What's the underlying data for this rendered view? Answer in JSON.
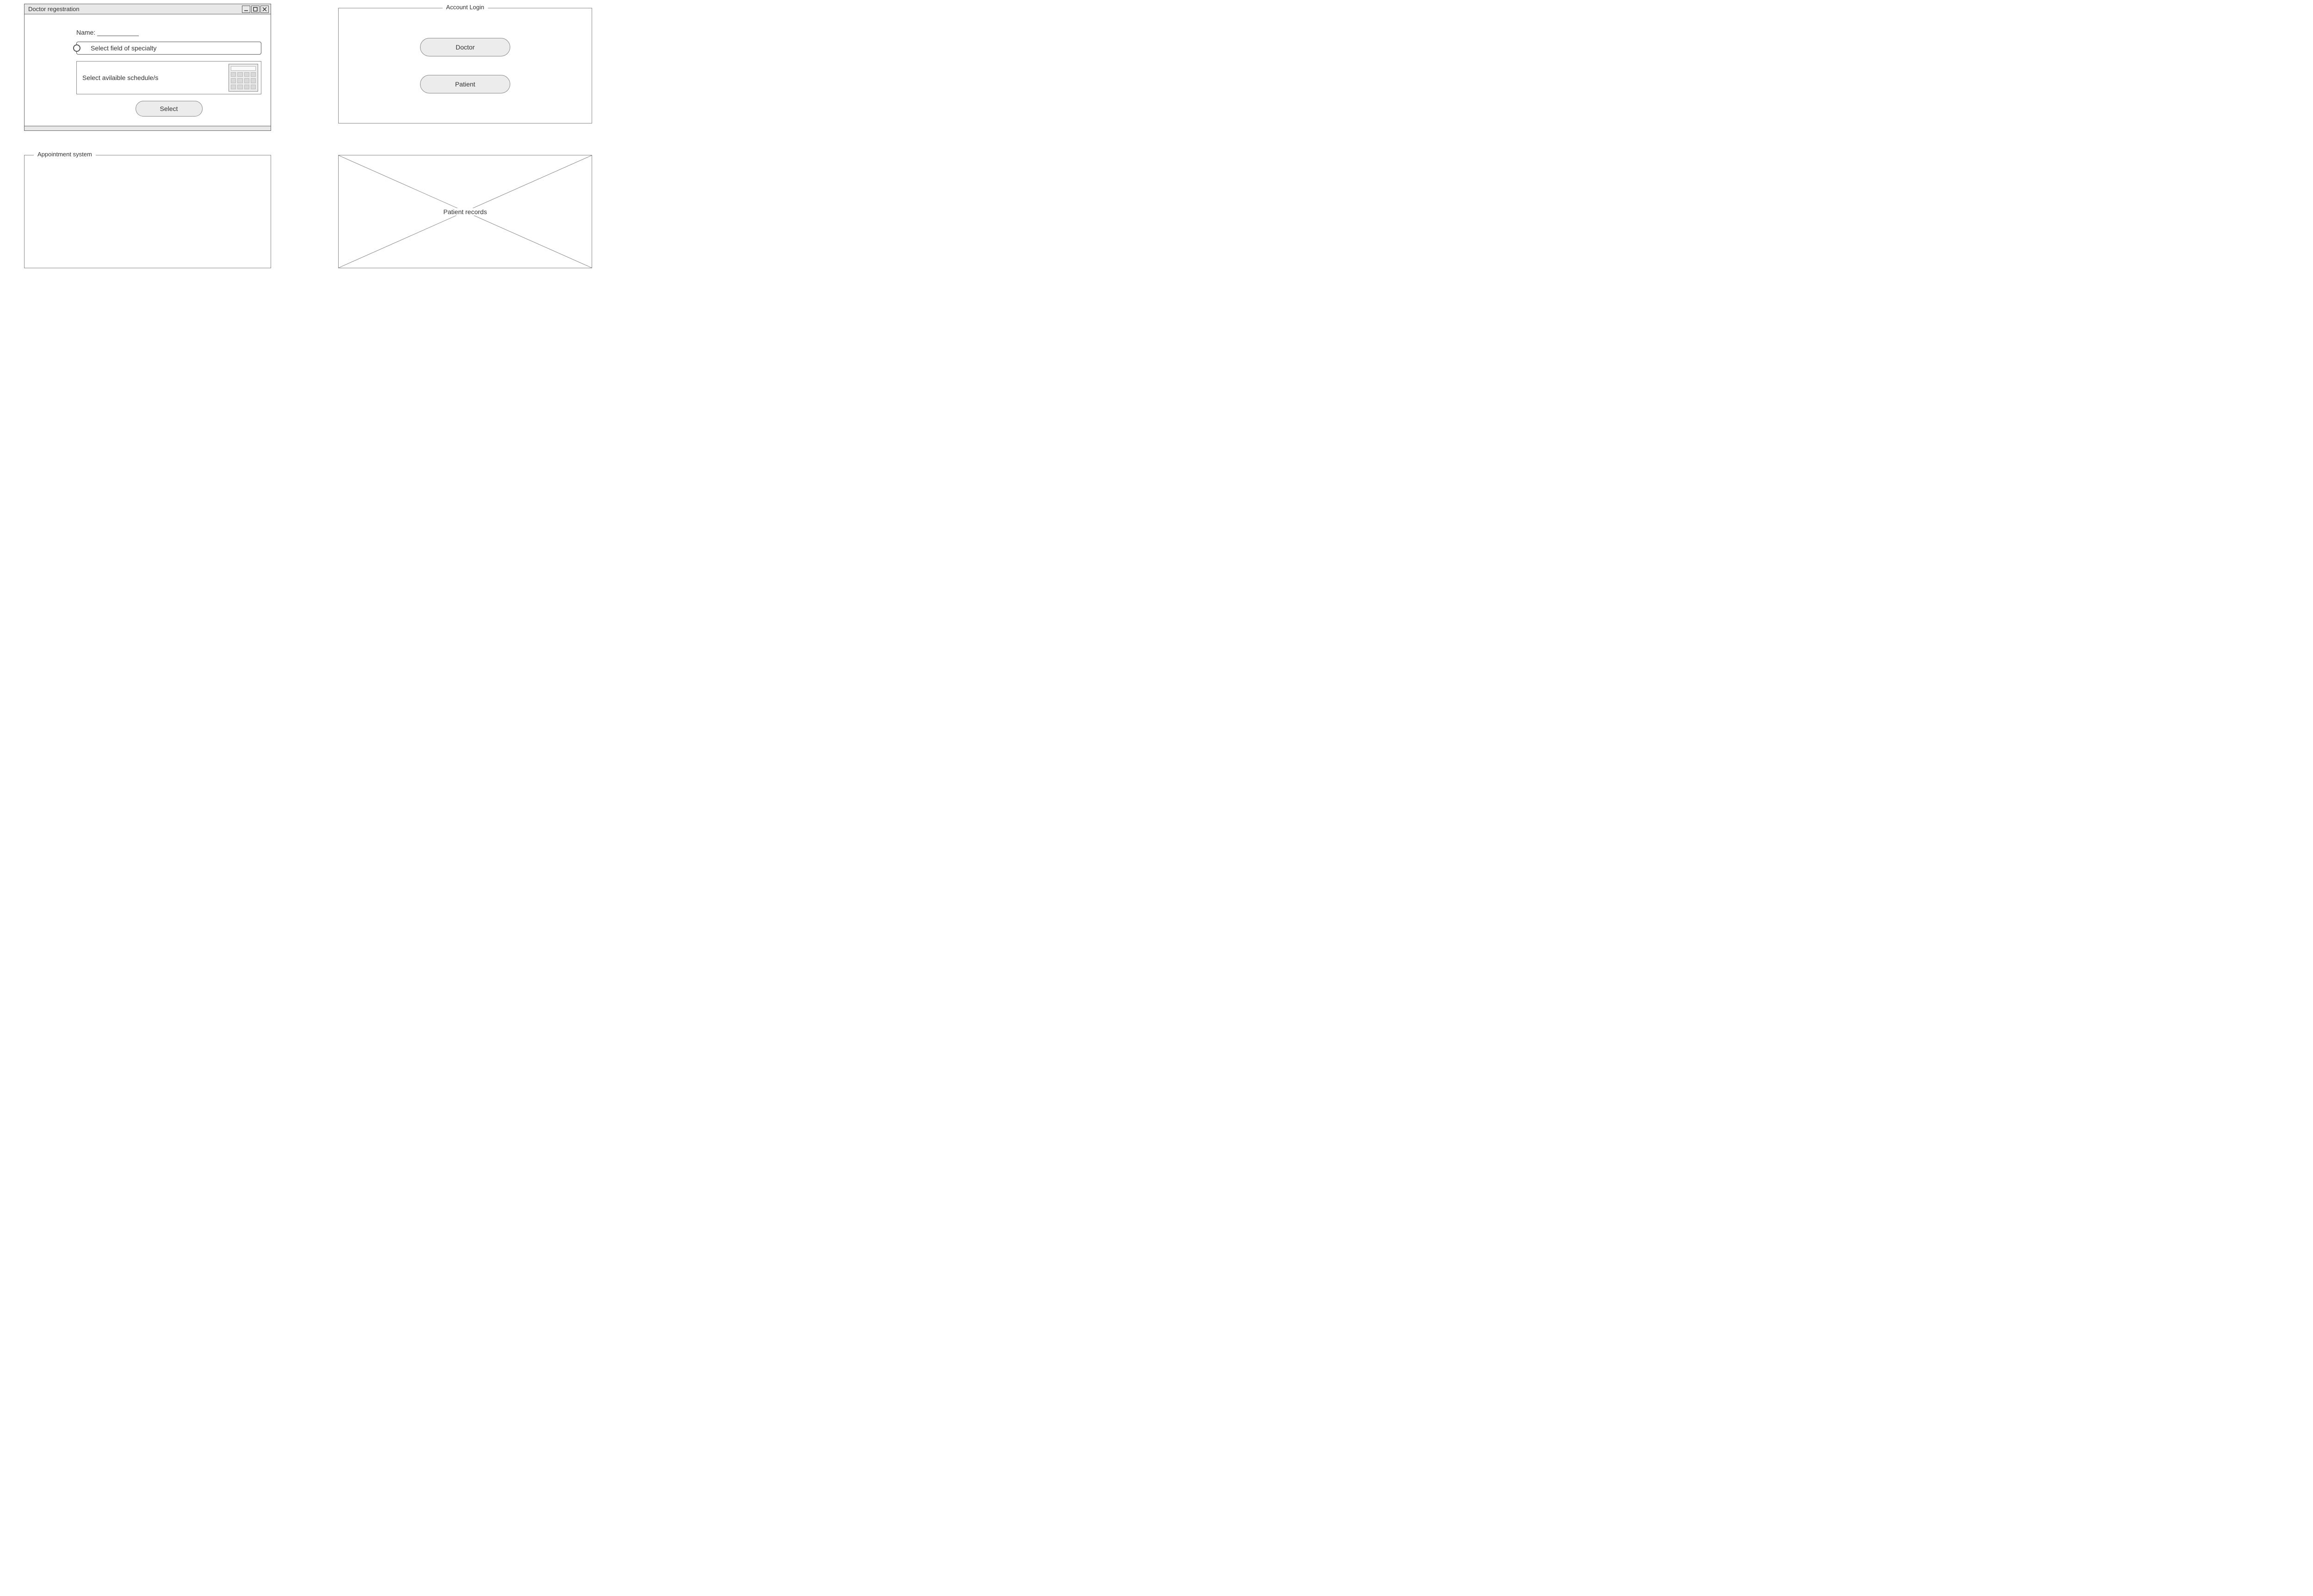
{
  "doctor_window": {
    "title": "Doctor regestration",
    "name_label": "Name:",
    "name_value": "",
    "specialty_placeholder": "Select field of specialty",
    "schedule_placeholder": "Select avilaible schedule/s",
    "select_button": "Select"
  },
  "account_login": {
    "title": "Account Login",
    "doctor_button": "Doctor",
    "patient_button": "Patient"
  },
  "appointment_system": {
    "title": "Appointment system"
  },
  "patient_records": {
    "label": "Patient records"
  }
}
